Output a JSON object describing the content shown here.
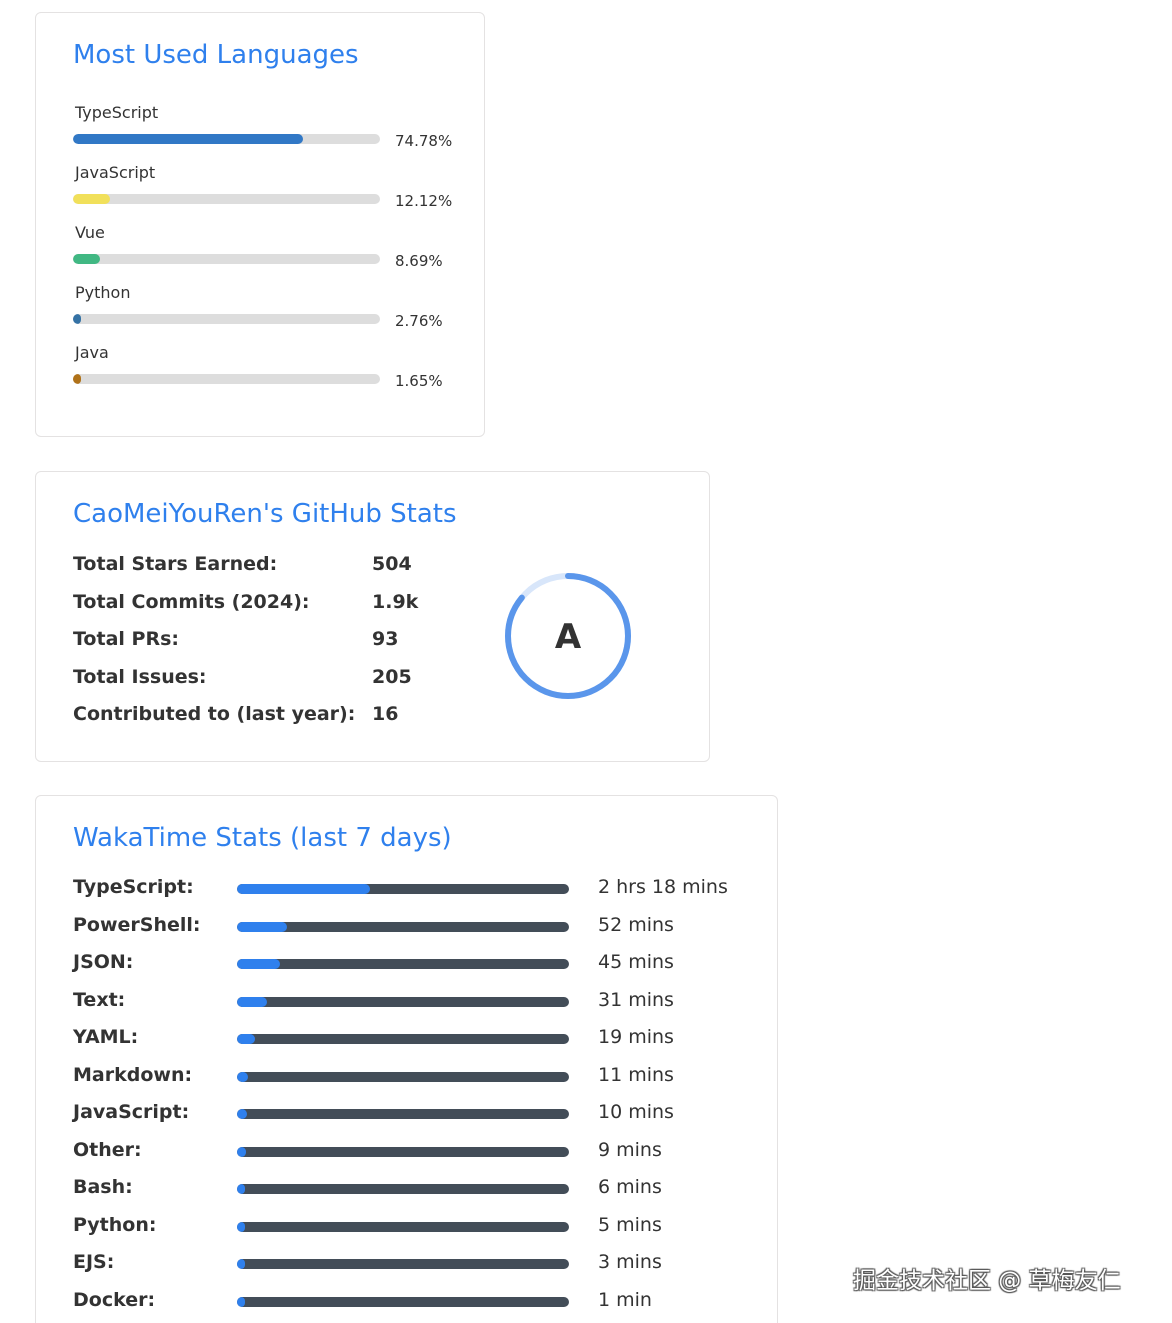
{
  "languages_card": {
    "title": "Most Used Languages",
    "items": [
      {
        "name": "TypeScript",
        "percent": 74.78,
        "label": "74.78%",
        "color": "#3178c6"
      },
      {
        "name": "JavaScript",
        "percent": 12.12,
        "label": "12.12%",
        "color": "#f1e05a"
      },
      {
        "name": "Vue",
        "percent": 8.69,
        "label": "8.69%",
        "color": "#41b883"
      },
      {
        "name": "Python",
        "percent": 2.76,
        "label": "2.76%",
        "color": "#3572a5"
      },
      {
        "name": "Java",
        "percent": 1.65,
        "label": "1.65%",
        "color": "#b07219"
      }
    ]
  },
  "github_stats_card": {
    "title": "CaoMeiYouRen's GitHub Stats",
    "stats": [
      {
        "label": "Total Stars Earned:",
        "value": "504"
      },
      {
        "label": "Total Commits (2024):",
        "value": "1.9k"
      },
      {
        "label": "Total PRs:",
        "value": "93"
      },
      {
        "label": "Total Issues:",
        "value": "205"
      },
      {
        "label": "Contributed to (last year):",
        "value": "16"
      }
    ],
    "rank": {
      "letter": "A",
      "progress": 0.86,
      "ring_color": "#5a96eb",
      "track_color": "#d8e6fa"
    }
  },
  "wakatime_card": {
    "title": "WakaTime Stats (last 7 days)",
    "bar_color": "#2f80ed",
    "track_color": "#434d58",
    "items": [
      {
        "name": "TypeScript:",
        "time": "2 hrs 18 mins",
        "percent": 40.0
      },
      {
        "name": "PowerShell:",
        "time": "52 mins",
        "percent": 15.1
      },
      {
        "name": "JSON:",
        "time": "45 mins",
        "percent": 13.1
      },
      {
        "name": "Text:",
        "time": "31 mins",
        "percent": 9.0
      },
      {
        "name": "YAML:",
        "time": "19 mins",
        "percent": 5.5
      },
      {
        "name": "Markdown:",
        "time": "11 mins",
        "percent": 3.2
      },
      {
        "name": "JavaScript:",
        "time": "10 mins",
        "percent": 2.9
      },
      {
        "name": "Other:",
        "time": "9 mins",
        "percent": 2.6
      },
      {
        "name": "Bash:",
        "time": "6 mins",
        "percent": 1.7
      },
      {
        "name": "Python:",
        "time": "5 mins",
        "percent": 1.5
      },
      {
        "name": "EJS:",
        "time": "3 mins",
        "percent": 0.9
      },
      {
        "name": "Docker:",
        "time": "1 min",
        "percent": 0.3
      }
    ]
  },
  "watermark": "掘金技术社区 @ 草梅友仁"
}
